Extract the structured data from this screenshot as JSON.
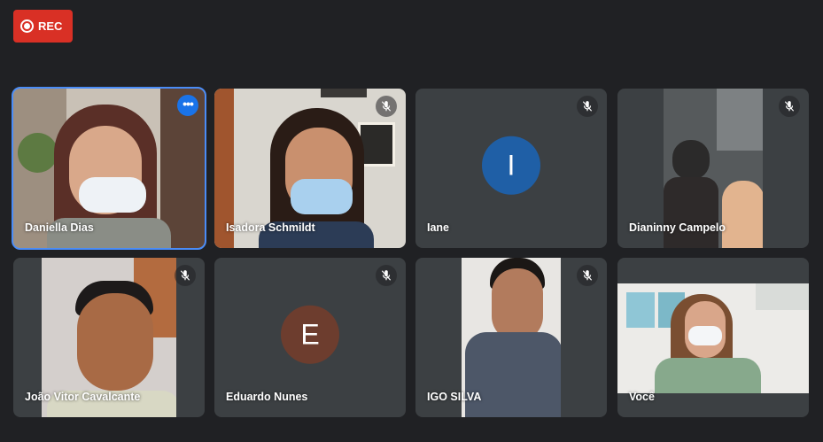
{
  "recording": {
    "label": "REC",
    "color": "#d93025"
  },
  "accent": "#1a73e8",
  "participants": [
    {
      "name": "Daniella Dias",
      "video": true,
      "active": true,
      "control": "more-options-icon"
    },
    {
      "name": "Isadora Schmildt",
      "video": true,
      "muted": true
    },
    {
      "name": "Iane",
      "video": false,
      "muted": true,
      "initial": "I",
      "avatar_color": "#1f5fa6"
    },
    {
      "name": "Dianinny Campelo",
      "video": true,
      "muted": true
    },
    {
      "name": "João Vitor Cavalcante",
      "video": true,
      "muted": true
    },
    {
      "name": "Eduardo Nunes",
      "video": false,
      "muted": true,
      "initial": "E",
      "avatar_color": "#6d3d2e"
    },
    {
      "name": "IGO SILVA",
      "video": true,
      "muted": true
    },
    {
      "name": "Você",
      "video": true
    }
  ]
}
